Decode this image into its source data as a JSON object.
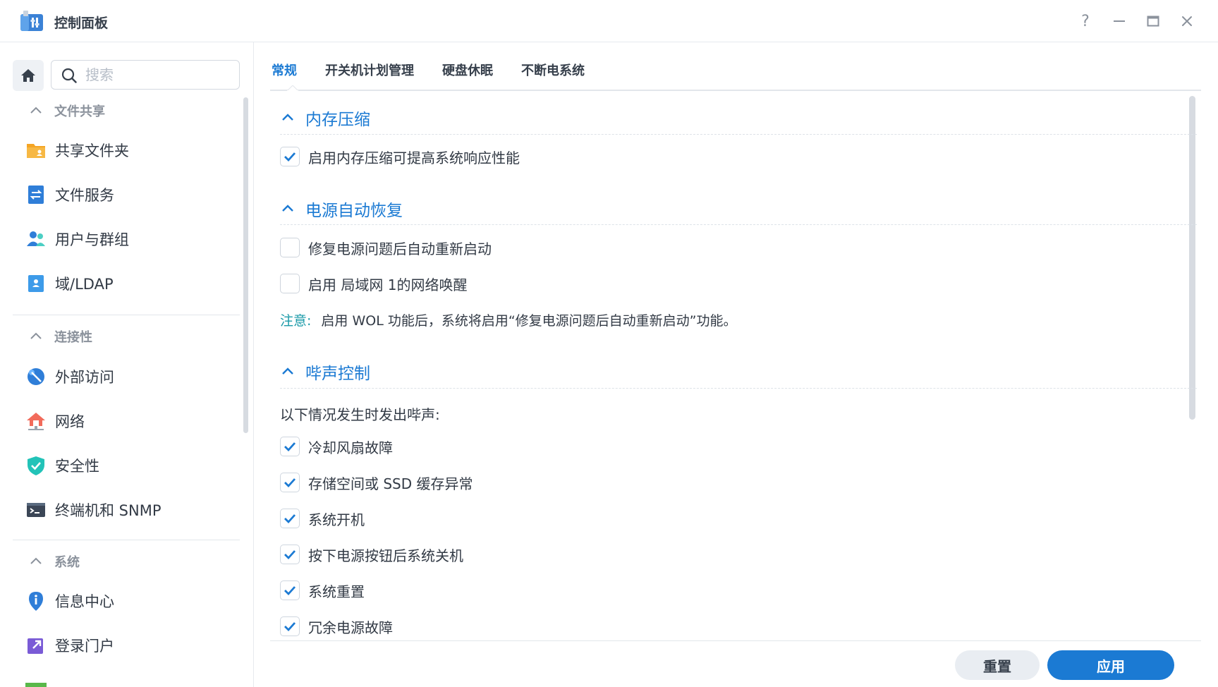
{
  "window": {
    "title": "控制面板",
    "controls": {
      "help": "?",
      "minimize": "—",
      "maximize": "□",
      "close": "×"
    }
  },
  "sidebar": {
    "search_placeholder": "搜索",
    "sections": [
      {
        "title": "文件共享",
        "items": [
          "共享文件夹",
          "文件服务",
          "用户与群组",
          "域/LDAP"
        ]
      },
      {
        "title": "连接性",
        "items": [
          "外部访问",
          "网络",
          "安全性",
          "终端机和 SNMP"
        ]
      },
      {
        "title": "系统",
        "items": [
          "信息中心",
          "登录门户"
        ]
      }
    ]
  },
  "tabs": [
    "常规",
    "开关机计划管理",
    "硬盘休眠",
    "不断电系统"
  ],
  "active_tab": 0,
  "groups": {
    "memory": {
      "title": "内存压缩",
      "options": [
        {
          "label": "启用内存压缩可提高系统响应性能",
          "checked": true
        }
      ]
    },
    "power": {
      "title": "电源自动恢复",
      "options": [
        {
          "label": "修复电源问题后自动重新启动",
          "checked": false
        },
        {
          "label": "启用 局域网 1的网络唤醒",
          "checked": false
        }
      ],
      "note_label": "注意:",
      "note_text": "启用 WOL 功能后，系统将启用“修复电源问题后自动重新启动”功能。"
    },
    "beep": {
      "title": "哔声控制",
      "intro": "以下情况发生时发出哔声:",
      "options": [
        {
          "label": "冷却风扇故障",
          "checked": true
        },
        {
          "label": "存储空间或 SSD 缓存异常",
          "checked": true
        },
        {
          "label": "系统开机",
          "checked": true
        },
        {
          "label": "按下电源按钮后系统关机",
          "checked": true
        },
        {
          "label": "系统重置",
          "checked": true
        },
        {
          "label": "冗余电源故障",
          "checked": true
        }
      ]
    }
  },
  "footer": {
    "reset_label": "重置",
    "apply_label": "应用"
  },
  "colors": {
    "accent": "#1b7ad3",
    "note": "#1a9aa8",
    "text": "#323a45"
  }
}
